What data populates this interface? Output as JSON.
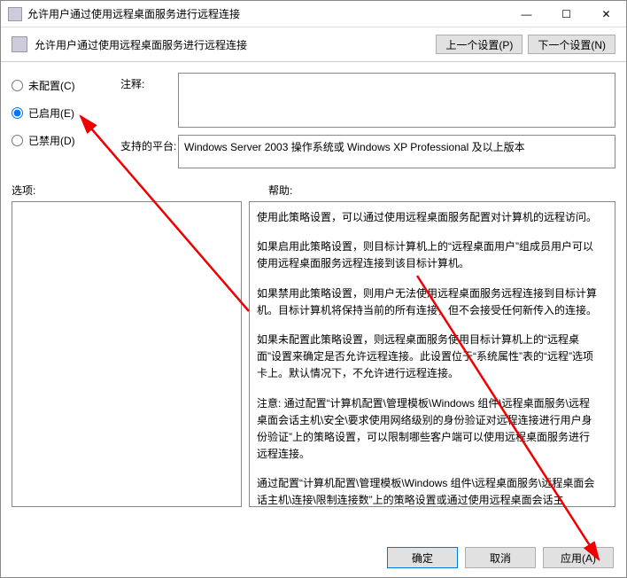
{
  "window": {
    "title": "允许用户通过使用远程桌面服务进行远程连接",
    "subtitle": "允许用户通过使用远程桌面服务进行远程连接"
  },
  "nav": {
    "prev": "上一个设置(P)",
    "next": "下一个设置(N)"
  },
  "radios": {
    "not_configured": "未配置(C)",
    "enabled": "已启用(E)",
    "disabled": "已禁用(D)"
  },
  "labels": {
    "comment": "注释:",
    "platform": "支持的平台:",
    "options": "选项:",
    "help": "帮助:"
  },
  "platform_text": "Windows Server 2003 操作系统或 Windows XP Professional 及以上版本",
  "help": {
    "p1": "使用此策略设置，可以通过使用远程桌面服务配置对计算机的远程访问。",
    "p2": "如果启用此策略设置，则目标计算机上的“远程桌面用户”组成员用户可以使用远程桌面服务远程连接到该目标计算机。",
    "p3": "如果禁用此策略设置，则用户无法使用远程桌面服务远程连接到目标计算机。目标计算机将保持当前的所有连接，但不会接受任何新传入的连接。",
    "p4": "如果未配置此策略设置，则远程桌面服务使用目标计算机上的“远程桌面”设置来确定是否允许远程连接。此设置位于“系统属性”表的“远程”选项卡上。默认情况下，不允许进行远程连接。",
    "p5": "注意: 通过配置“计算机配置\\管理模板\\Windows 组件\\远程桌面服务\\远程桌面会话主机\\安全\\要求使用网络级别的身份验证对远程连接进行用户身份验证”上的策略设置，可以限制哪些客户端可以使用远程桌面服务进行远程连接。",
    "p6": "通过配置“计算机配置\\管理模板\\Windows 组件\\远程桌面服务\\远程桌面会话主机\\连接\\限制连接数”上的策略设置或通过使用远程桌面会话主"
  },
  "buttons": {
    "ok": "确定",
    "cancel": "取消",
    "apply": "应用(A)"
  },
  "win_controls": {
    "min": "—",
    "max": "☐",
    "close": "✕"
  }
}
